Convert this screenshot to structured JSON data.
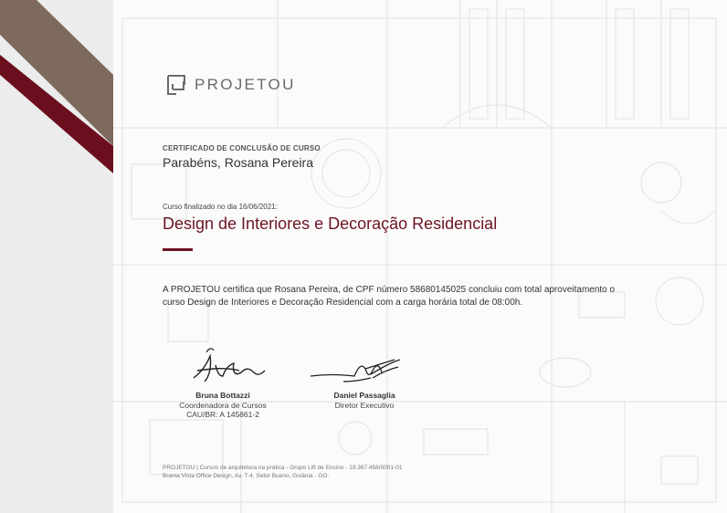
{
  "brand": {
    "name": "PROJETOU"
  },
  "certificate": {
    "eyebrow": "CERTIFICADO DE CONCLUSÃO DE CURSO",
    "congrats": "Parabéns, Rosana Pereira",
    "finished_on": "Curso finalizado no dia 16/06/2021:",
    "course_title": "Design de Interiores e Decoração Residencial",
    "body_line1": "A PROJETOU certifica que Rosana Pereira, de CPF número 58680145025 concluiu com total aproveitamento o",
    "body_line2": "curso Design de Interiores e Decoração Residencial com a carga horária total de 08:00h."
  },
  "signatures": [
    {
      "name": "Bruna Bottazzi",
      "role": "Coordenadora de Cursos",
      "registration": "CAU/BR: A 145861-2"
    },
    {
      "name": "Daniel Passaglia",
      "role": "Diretor Executivo"
    }
  ],
  "footer": {
    "line1": "PROJETOU | Cursos de arquitetura na prática - Grupo Lift de Ensino - 19.367.458/0001-01",
    "line2": "Buena Vista Office Design, Av. T-4, Setor Bueno, Goiânia - GO."
  },
  "colors": {
    "accent": "#6d1423",
    "band_brown": "#7d6a5d",
    "band_red": "#6b0f1e",
    "plan_lines": "#e6e6e6"
  },
  "icons": [
    "projetou-logo-icon"
  ]
}
